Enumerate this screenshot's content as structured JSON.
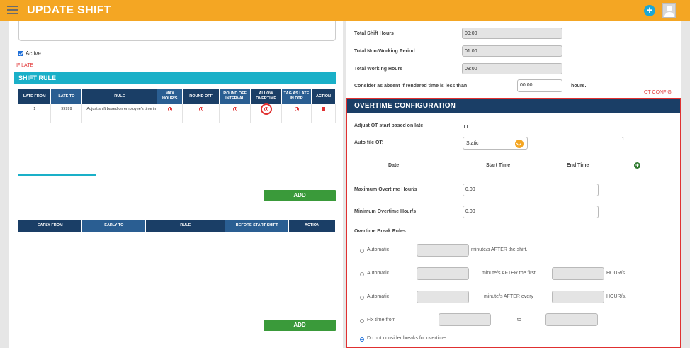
{
  "header": {
    "title": "UPDATE SHIFT"
  },
  "left": {
    "active_label": "Active",
    "if_late": "IF LATE",
    "shift_rule_title": "SHIFT RULE",
    "late_table": {
      "headers": [
        "LATE FROM",
        "LATE TO",
        "RULE",
        "MAX HOUR/S",
        "ROUND OFF",
        "ROUND OFF INTERVAL",
        "ALLOW OVERTIME",
        "TAG AS LATE IN DTR",
        "ACTION"
      ],
      "row": {
        "late_from": "1",
        "late_to": "99999",
        "rule": "Adjust shift based on employee's time in"
      }
    },
    "add_label": "ADD",
    "early_table": {
      "headers": [
        "EARLY FROM",
        "EARLY TO",
        "RULE",
        "BEFORE START SHIFT",
        "ACTION"
      ]
    },
    "add_label2": "ADD"
  },
  "right": {
    "total_shift_hours": {
      "label": "Total Shift Hours",
      "value": "09:00"
    },
    "total_non_working": {
      "label": "Total Non-Working Period",
      "value": "01:00"
    },
    "total_working": {
      "label": "Total Working Hours",
      "value": "08:00"
    },
    "absent": {
      "label": "Consider as absent if rendered time is less than",
      "value": "00:00",
      "suffix": "hours."
    },
    "ot_config_link": "OT CONFIG",
    "ot": {
      "title": "OVERTIME CONFIGURATION",
      "adjust_label": "Adjust OT start based on late",
      "auto_file_label": "Auto file OT:",
      "auto_file_value": "Static",
      "count": "1",
      "cols": {
        "date": "Date",
        "start": "Start Time",
        "end": "End Time"
      },
      "max_label": "Maximum Overtime Hour/s",
      "max_value": "0.00",
      "min_label": "Minimum Overtime Hour/s",
      "min_value": "0.00",
      "break_rules_label": "Overtime Break Rules",
      "r1": {
        "label": "Automatic",
        "text": "minute/s AFTER the shift."
      },
      "r2": {
        "label": "Automatic",
        "text": "minute/s AFTER the first",
        "text2": "HOUR/s."
      },
      "r3": {
        "label": "Automatic",
        "text": "minute/s AFTER every",
        "text2": "HOUR/s."
      },
      "r4": {
        "label": "Fix time from",
        "to": "to"
      },
      "r5": {
        "label": "Do not consider breaks for overtime"
      }
    }
  },
  "colors": {
    "header": "#f4a623",
    "teal": "#1ab0c8",
    "navy": "#1a3e66",
    "green": "#3a9a3a",
    "red": "#e03030"
  }
}
